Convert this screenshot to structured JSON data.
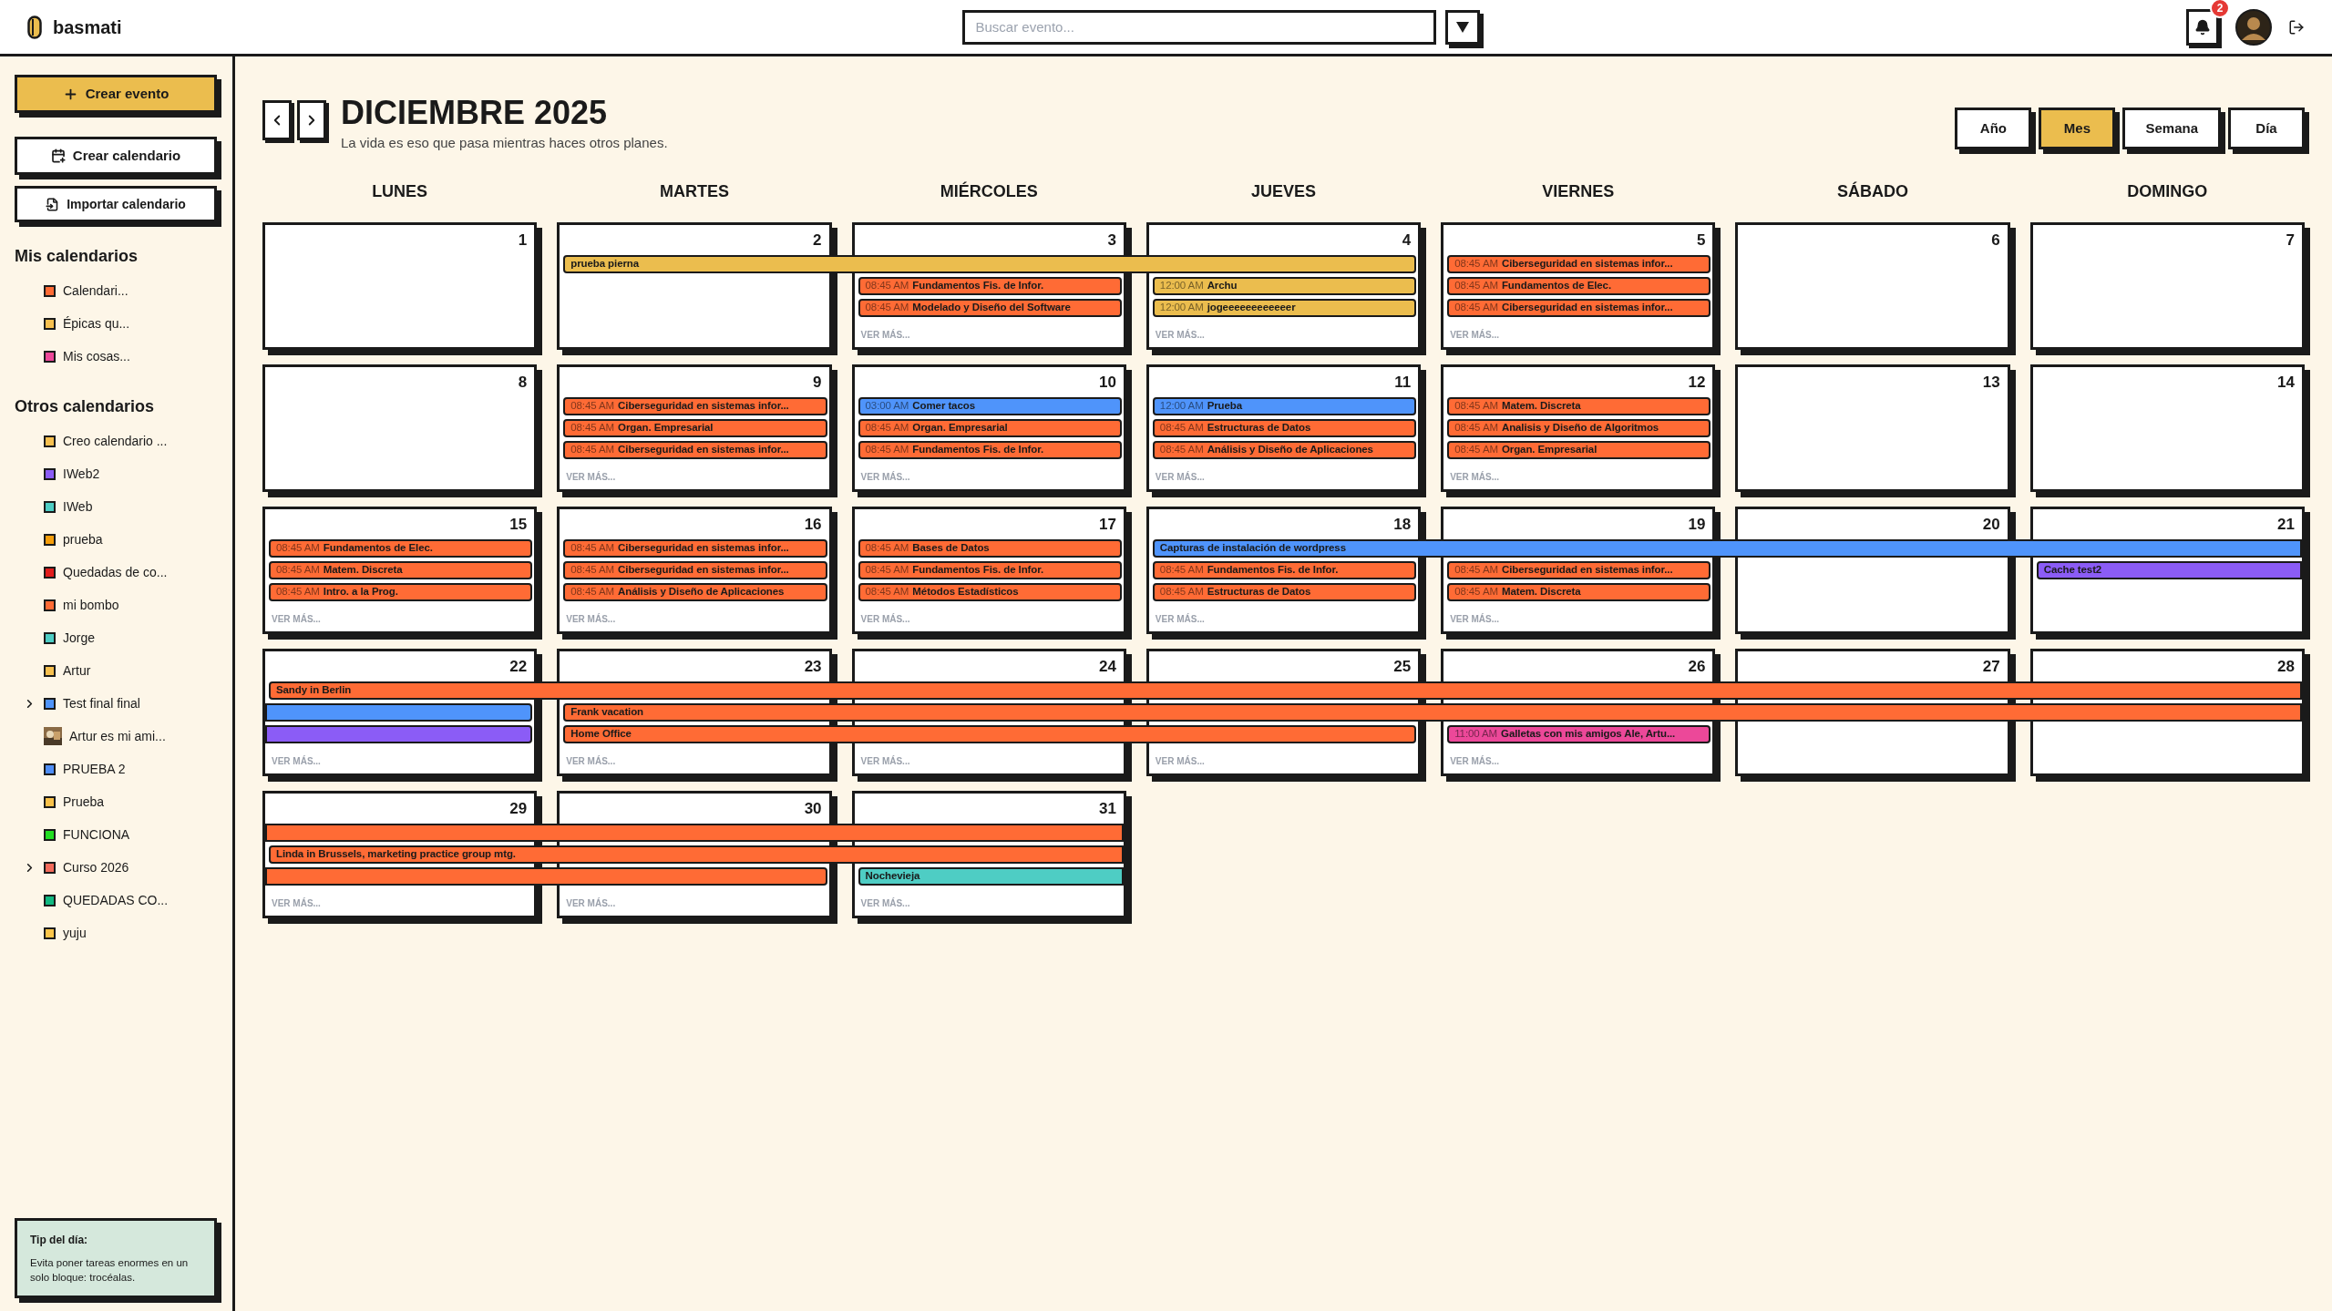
{
  "app": {
    "name": "basmati"
  },
  "search": {
    "placeholder": "Buscar evento..."
  },
  "notifications": {
    "count": "2"
  },
  "sidebar": {
    "create_event": "Crear evento",
    "create_calendar": "Crear calendario",
    "import_calendar": "Importar calendario",
    "sections": [
      {
        "title": "Mis calendarios",
        "items": [
          {
            "kind": "color",
            "label": "Calendari...",
            "color": "#ff6b35",
            "has_children": false
          },
          {
            "kind": "color",
            "label": "Épicas qu...",
            "color": "#f6c04f",
            "has_children": false
          },
          {
            "kind": "color",
            "label": "Mis cosas...",
            "color": "#ec4899",
            "has_children": false
          }
        ]
      },
      {
        "title": "Otros calendarios",
        "items": [
          {
            "kind": "color",
            "label": "Creo calendario ...",
            "color": "#f6c04f",
            "has_children": false
          },
          {
            "kind": "color",
            "label": "IWeb2",
            "color": "#8b5cf6",
            "has_children": false
          },
          {
            "kind": "color",
            "label": "IWeb",
            "color": "#4ecdc4",
            "has_children": false
          },
          {
            "kind": "color",
            "label": "prueba",
            "color": "#f59e0b",
            "has_children": false
          },
          {
            "kind": "color",
            "label": "Quedadas de co...",
            "color": "#e11d1d",
            "has_children": false
          },
          {
            "kind": "color",
            "label": "mi bombo",
            "color": "#ff6b35",
            "has_children": false
          },
          {
            "kind": "color",
            "label": "Jorge",
            "color": "#4ecdc4",
            "has_children": false
          },
          {
            "kind": "color",
            "label": "Artur",
            "color": "#f6c04f",
            "has_children": false
          },
          {
            "kind": "color",
            "label": "Test final final",
            "color": "#4f94fb",
            "has_children": true
          },
          {
            "label": "Artur es mi ami...",
            "has_children": false
          },
          {
            "kind": "color",
            "label": "PRUEBA 2",
            "color": "#4f8ef7",
            "has_children": false
          },
          {
            "kind": "color",
            "label": "Prueba",
            "color": "#f8c14a",
            "has_children": false
          },
          {
            "kind": "color",
            "label": "FUNCIONA",
            "color": "#22dd22",
            "has_children": false
          },
          {
            "kind": "color",
            "label": "Curso 2026",
            "color": "#f26b5b",
            "has_children": true
          },
          {
            "kind": "color",
            "label": "QUEDADAS CO...",
            "color": "#10b981",
            "has_children": false
          },
          {
            "kind": "color",
            "label": "yuju",
            "color": "#fbc54a",
            "has_children": false
          }
        ]
      }
    ],
    "tip": {
      "title": "Tip del día:",
      "text": "Evita poner tareas enormes en un solo bloque: trocéalas."
    }
  },
  "calendar": {
    "title": "DICIEMBRE 2025",
    "subtitle": "La vida es eso que pasa mientras haces otros planes.",
    "views": [
      {
        "label": "Año",
        "selected": false
      },
      {
        "label": "Mes",
        "selected": true
      },
      {
        "label": "Semana",
        "selected": false
      },
      {
        "label": "Día",
        "selected": false
      }
    ],
    "weekdays": [
      "LUNES",
      "MARTES",
      "MIÉRCOLES",
      "JUEVES",
      "VIERNES",
      "SÁBADO",
      "DOMINGO"
    ],
    "weeks": [
      {
        "days": [
          {
            "number": "1"
          },
          {
            "number": "2"
          },
          {
            "number": "3",
            "more": "VER MÁS..."
          },
          {
            "number": "4",
            "more": "VER MÁS..."
          },
          {
            "number": "5",
            "more": "VER MÁS..."
          },
          {
            "number": "6"
          },
          {
            "number": "7"
          }
        ],
        "lanes": [
          [
            {
              "kind": "none"
            },
            {
              "kind": "event",
              "title": "prueba pierna",
              "color": "#ebbd4e",
              "from_before": false,
              "to_after": false
            },
            {
              "kind": "continued"
            },
            {
              "kind": "continued"
            },
            {
              "kind": "event",
              "time": "08:45 AM",
              "title": "Ciberseguridad en sistemas infor...",
              "color": "#ff6b35",
              "from_before": false,
              "to_after": false
            },
            {
              "kind": "none"
            },
            {
              "kind": "none"
            }
          ],
          [
            {
              "kind": "none"
            },
            {
              "kind": "none"
            },
            {
              "kind": "event",
              "time": "08:45 AM",
              "title": "Fundamentos Fis. de Infor.",
              "color": "#ff6b35",
              "from_before": false,
              "to_after": false
            },
            {
              "kind": "event",
              "time": "12:00 AM",
              "title": "Archu",
              "color": "#ebbd4e",
              "from_before": false,
              "to_after": false
            },
            {
              "kind": "event",
              "time": "08:45 AM",
              "title": "Fundamentos de Elec.",
              "color": "#ff6b35",
              "from_before": false,
              "to_after": false
            },
            {
              "kind": "none"
            },
            {
              "kind": "none"
            }
          ],
          [
            {
              "kind": "none"
            },
            {
              "kind": "none"
            },
            {
              "kind": "event",
              "time": "08:45 AM",
              "title": "Modelado y Diseño del Software",
              "color": "#ff6b35",
              "from_before": false,
              "to_after": false
            },
            {
              "kind": "event",
              "time": "12:00 AM",
              "title": "jogeeeeeeeeeeeer",
              "color": "#ebbd4e",
              "from_before": false,
              "to_after": false
            },
            {
              "kind": "event",
              "time": "08:45 AM",
              "title": "Ciberseguridad en sistemas infor...",
              "color": "#ff6b35",
              "from_before": false,
              "to_after": false
            },
            {
              "kind": "none"
            },
            {
              "kind": "none"
            }
          ]
        ]
      },
      {
        "days": [
          {
            "number": "8"
          },
          {
            "number": "9",
            "more": "VER MÁS..."
          },
          {
            "number": "10",
            "more": "VER MÁS..."
          },
          {
            "number": "11",
            "more": "VER MÁS..."
          },
          {
            "number": "12",
            "more": "VER MÁS..."
          },
          {
            "number": "13"
          },
          {
            "number": "14"
          }
        ],
        "lanes": [
          [
            {
              "kind": "none"
            },
            {
              "kind": "event",
              "time": "08:45 AM",
              "title": "Ciberseguridad en sistemas infor...",
              "color": "#ff6b35",
              "from_before": false,
              "to_after": false
            },
            {
              "kind": "event",
              "time": "03:00 AM",
              "title": "Comer tacos",
              "color": "#4f94fb",
              "from_before": false,
              "to_after": false
            },
            {
              "kind": "event",
              "time": "12:00 AM",
              "title": "Prueba",
              "color": "#4f94fb",
              "from_before": false,
              "to_after": false
            },
            {
              "kind": "event",
              "time": "08:45 AM",
              "title": "Matem. Discreta",
              "color": "#ff6b35",
              "from_before": false,
              "to_after": false
            },
            {
              "kind": "none"
            },
            {
              "kind": "none"
            }
          ],
          [
            {
              "kind": "none"
            },
            {
              "kind": "event",
              "time": "08:45 AM",
              "title": "Organ. Empresarial",
              "color": "#ff6b35",
              "from_before": false,
              "to_after": false
            },
            {
              "kind": "event",
              "time": "08:45 AM",
              "title": "Organ. Empresarial",
              "color": "#ff6b35",
              "from_before": false,
              "to_after": false
            },
            {
              "kind": "event",
              "time": "08:45 AM",
              "title": "Estructuras de Datos",
              "color": "#ff6b35",
              "from_before": false,
              "to_after": false
            },
            {
              "kind": "event",
              "time": "08:45 AM",
              "title": "Analisis y Diseño de Algoritmos",
              "color": "#ff6b35",
              "from_before": false,
              "to_after": false
            },
            {
              "kind": "none"
            },
            {
              "kind": "none"
            }
          ],
          [
            {
              "kind": "none"
            },
            {
              "kind": "event",
              "time": "08:45 AM",
              "title": "Ciberseguridad en sistemas infor...",
              "color": "#ff6b35",
              "from_before": false,
              "to_after": false
            },
            {
              "kind": "event",
              "time": "08:45 AM",
              "title": "Fundamentos Fis. de Infor.",
              "color": "#ff6b35",
              "from_before": false,
              "to_after": false
            },
            {
              "kind": "event",
              "time": "08:45 AM",
              "title": "Análisis y Diseño de Aplicaciones",
              "color": "#ff6b35",
              "from_before": false,
              "to_after": false
            },
            {
              "kind": "event",
              "time": "08:45 AM",
              "title": "Organ. Empresarial",
              "color": "#ff6b35",
              "from_before": false,
              "to_after": false
            },
            {
              "kind": "none"
            },
            {
              "kind": "none"
            }
          ]
        ]
      },
      {
        "days": [
          {
            "number": "15",
            "more": "VER MÁS..."
          },
          {
            "number": "16",
            "more": "VER MÁS..."
          },
          {
            "number": "17",
            "more": "VER MÁS..."
          },
          {
            "number": "18",
            "more": "VER MÁS..."
          },
          {
            "number": "19",
            "more": "VER MÁS..."
          },
          {
            "number": "20"
          },
          {
            "number": "21"
          }
        ],
        "lanes": [
          [
            {
              "kind": "event",
              "time": "08:45 AM",
              "title": "Fundamentos de Elec.",
              "color": "#ff6b35",
              "from_before": false,
              "to_after": false
            },
            {
              "kind": "event",
              "time": "08:45 AM",
              "title": "Ciberseguridad en sistemas infor...",
              "color": "#ff6b35",
              "from_before": false,
              "to_after": false
            },
            {
              "kind": "event",
              "time": "08:45 AM",
              "title": "Bases de Datos",
              "color": "#ff6b35",
              "from_before": false,
              "to_after": false
            },
            {
              "kind": "event",
              "title": "Capturas de instalación de wordpress",
              "color": "#4f94fb",
              "from_before": false,
              "to_after": true
            },
            {
              "kind": "continued"
            },
            {
              "kind": "continued"
            },
            {
              "kind": "continued"
            }
          ],
          [
            {
              "kind": "event",
              "time": "08:45 AM",
              "title": "Matem. Discreta",
              "color": "#ff6b35",
              "from_before": false,
              "to_after": false
            },
            {
              "kind": "event",
              "time": "08:45 AM",
              "title": "Ciberseguridad en sistemas infor...",
              "color": "#ff6b35",
              "from_before": false,
              "to_after": false
            },
            {
              "kind": "event",
              "time": "08:45 AM",
              "title": "Fundamentos Fis. de Infor.",
              "color": "#ff6b35",
              "from_before": false,
              "to_after": false
            },
            {
              "kind": "event",
              "time": "08:45 AM",
              "title": "Fundamentos Fis. de Infor.",
              "color": "#ff6b35",
              "from_before": false,
              "to_after": false
            },
            {
              "kind": "event",
              "time": "08:45 AM",
              "title": "Ciberseguridad en sistemas infor...",
              "color": "#ff6b35",
              "from_before": false,
              "to_after": false
            },
            {
              "kind": "none"
            },
            {
              "kind": "event",
              "title": "Cache test2",
              "color": "#8b5cf6",
              "from_before": false,
              "to_after": true
            }
          ],
          [
            {
              "kind": "event",
              "time": "08:45 AM",
              "title": "Intro. a la Prog.",
              "color": "#ff6b35",
              "from_before": false,
              "to_after": false
            },
            {
              "kind": "event",
              "time": "08:45 AM",
              "title": "Análisis y Diseño de Aplicaciones",
              "color": "#ff6b35",
              "from_before": false,
              "to_after": false
            },
            {
              "kind": "event",
              "time": "08:45 AM",
              "title": "Métodos Estadísticos",
              "color": "#ff6b35",
              "from_before": false,
              "to_after": false
            },
            {
              "kind": "event",
              "time": "08:45 AM",
              "title": "Estructuras de Datos",
              "color": "#ff6b35",
              "from_before": false,
              "to_after": false
            },
            {
              "kind": "event",
              "time": "08:45 AM",
              "title": "Matem. Discreta",
              "color": "#ff6b35",
              "from_before": false,
              "to_after": false
            },
            {
              "kind": "none"
            },
            {
              "kind": "none"
            }
          ]
        ]
      },
      {
        "days": [
          {
            "number": "22",
            "more": "VER MÁS..."
          },
          {
            "number": "23",
            "more": "VER MÁS..."
          },
          {
            "number": "24",
            "more": "VER MÁS..."
          },
          {
            "number": "25",
            "more": "VER MÁS..."
          },
          {
            "number": "26",
            "more": "VER MÁS..."
          },
          {
            "number": "27"
          },
          {
            "number": "28"
          }
        ],
        "lanes": [
          [
            {
              "kind": "event",
              "title": "Sandy in Berlin",
              "color": "#ff6b35",
              "from_before": false,
              "to_after": true
            },
            {
              "kind": "continued"
            },
            {
              "kind": "continued"
            },
            {
              "kind": "continued"
            },
            {
              "kind": "continued"
            },
            {
              "kind": "continued"
            },
            {
              "kind": "continued"
            }
          ],
          [
            {
              "kind": "event",
              "color": "#4f94fb",
              "from_before": true,
              "to_after": false
            },
            {
              "kind": "event",
              "title": "Frank vacation",
              "color": "#ff6b35",
              "from_before": false,
              "to_after": true
            },
            {
              "kind": "continued"
            },
            {
              "kind": "continued"
            },
            {
              "kind": "continued"
            },
            {
              "kind": "continued"
            },
            {
              "kind": "continued"
            }
          ],
          [
            {
              "kind": "event",
              "color": "#8b5cf6",
              "from_before": true,
              "to_after": false
            },
            {
              "kind": "event",
              "title": "Home Office",
              "color": "#ff6b35",
              "from_before": false,
              "to_after": false
            },
            {
              "kind": "continued"
            },
            {
              "kind": "continued"
            },
            {
              "kind": "event",
              "time": "11:00 AM",
              "title": "Galletas con mis amigos Ale, Artu...",
              "color": "#ec4899",
              "from_before": false,
              "to_after": false
            },
            {
              "kind": "none"
            },
            {
              "kind": "none"
            }
          ]
        ]
      },
      {
        "days": [
          {
            "number": "29",
            "more": "VER MÁS..."
          },
          {
            "number": "30",
            "more": "VER MÁS..."
          },
          {
            "number": "31",
            "more": "VER MÁS..."
          }
        ],
        "lanes": [
          [
            {
              "kind": "event",
              "color": "#ff6b35",
              "from_before": true,
              "to_after": true
            },
            {
              "kind": "continued"
            },
            {
              "kind": "continued"
            }
          ],
          [
            {
              "kind": "event",
              "title": "Linda in Brussels, marketing practice group mtg.",
              "color": "#ff6b35",
              "from_before": false,
              "to_after": true
            },
            {
              "kind": "continued"
            },
            {
              "kind": "continued"
            }
          ],
          [
            {
              "kind": "event",
              "color": "#ff6b35",
              "from_before": true,
              "to_after": false
            },
            {
              "kind": "continued"
            },
            {
              "kind": "event",
              "title": "Nochevieja",
              "color": "#4ecdc4",
              "from_before": false,
              "to_after": true
            }
          ]
        ]
      }
    ]
  }
}
